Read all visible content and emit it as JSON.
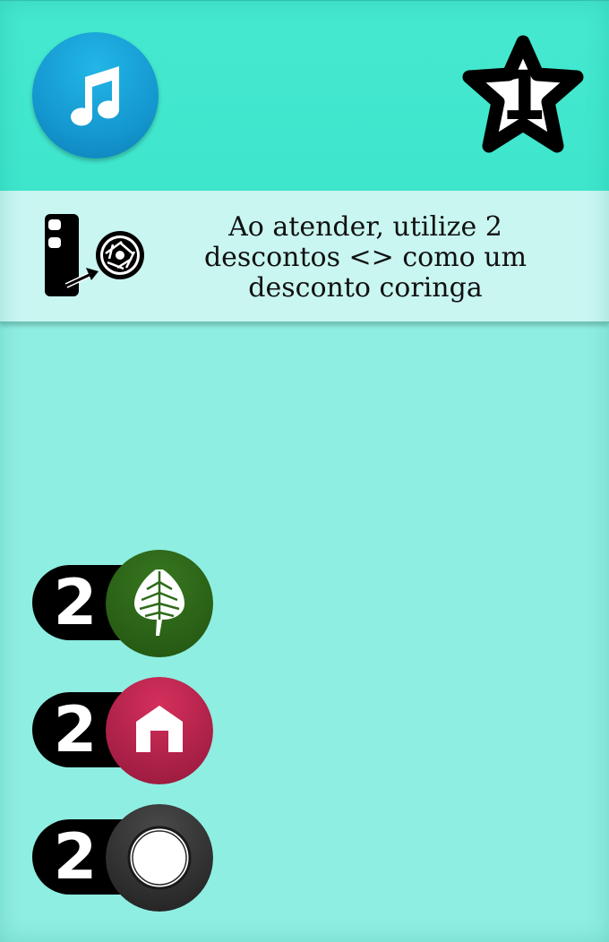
{
  "card": {
    "background": "#8eeee1",
    "header_color": "#3ee6cc",
    "music_button": {
      "icon": "music-note-icon",
      "color": "#1598d0"
    },
    "level": {
      "value": "1",
      "icon": "star-icon"
    }
  },
  "ability": {
    "icon": "phone-to-aperture-icon",
    "text_line1": "Ao atender, utilize 2",
    "text_line2": "descontos <> como um",
    "text_line3": "desconto coringa"
  },
  "discounts": [
    {
      "value": "2",
      "icon": "leaf-icon",
      "color": "#2f6a1a"
    },
    {
      "value": "2",
      "icon": "house-icon",
      "color": "#c0254f"
    },
    {
      "value": "2",
      "icon": "circle-icon",
      "color": "#3a3a3a"
    }
  ]
}
